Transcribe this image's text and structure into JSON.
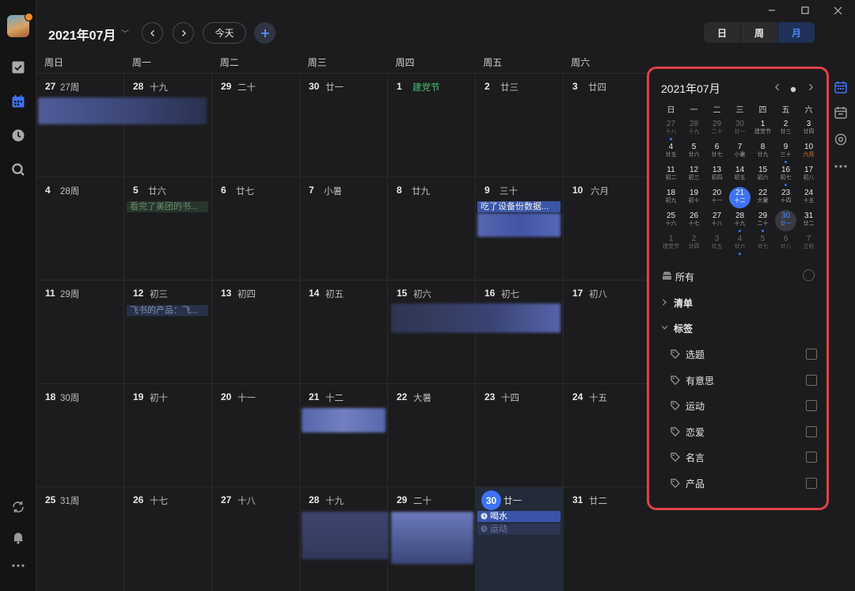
{
  "header": {
    "month_title": "2021年07月",
    "today_button": "今天",
    "view_modes": [
      "日",
      "周",
      "月"
    ],
    "active_view": "月"
  },
  "weekdays": [
    "周日",
    "周一",
    "周二",
    "周三",
    "周四",
    "周五",
    "周六"
  ],
  "weeks": [
    [
      {
        "day": "27",
        "info": "27周"
      },
      {
        "day": "28",
        "info": "十九"
      },
      {
        "day": "29",
        "info": "二十"
      },
      {
        "day": "30",
        "info": "廿一"
      },
      {
        "day": "1",
        "info": "建党节",
        "festival": true
      },
      {
        "day": "2",
        "info": "廿三"
      },
      {
        "day": "3",
        "info": "廿四"
      }
    ],
    [
      {
        "day": "4",
        "info": "28周"
      },
      {
        "day": "5",
        "info": "廿六"
      },
      {
        "day": "6",
        "info": "廿七"
      },
      {
        "day": "7",
        "info": "小暑"
      },
      {
        "day": "8",
        "info": "廿九"
      },
      {
        "day": "9",
        "info": "三十"
      },
      {
        "day": "10",
        "info": "六月"
      }
    ],
    [
      {
        "day": "11",
        "info": "29周"
      },
      {
        "day": "12",
        "info": "初三"
      },
      {
        "day": "13",
        "info": "初四"
      },
      {
        "day": "14",
        "info": "初五"
      },
      {
        "day": "15",
        "info": "初六"
      },
      {
        "day": "16",
        "info": "初七"
      },
      {
        "day": "17",
        "info": "初八"
      }
    ],
    [
      {
        "day": "18",
        "info": "30周"
      },
      {
        "day": "19",
        "info": "初十"
      },
      {
        "day": "20",
        "info": "十一"
      },
      {
        "day": "21",
        "info": "十二"
      },
      {
        "day": "22",
        "info": "大暑"
      },
      {
        "day": "23",
        "info": "十四"
      },
      {
        "day": "24",
        "info": "十五"
      }
    ],
    [
      {
        "day": "25",
        "info": "31周"
      },
      {
        "day": "26",
        "info": "十七"
      },
      {
        "day": "27",
        "info": "十八"
      },
      {
        "day": "28",
        "info": "十九"
      },
      {
        "day": "29",
        "info": "二十"
      },
      {
        "day": "30",
        "info": "廿一",
        "today": true
      },
      {
        "day": "31",
        "info": "廿二"
      }
    ]
  ],
  "events": {
    "book_done": "看完了美团的书...",
    "backup": "吃了设备份数据...",
    "feishu": "飞书的产品：飞...",
    "drink_water": "喝水",
    "exercise": "运动"
  },
  "mini_calendar": {
    "title": "2021年07月",
    "weekday_heads": [
      "日",
      "一",
      "二",
      "三",
      "四",
      "五",
      "六"
    ],
    "rows": [
      [
        {
          "n": "27",
          "l": "十八",
          "dim": true,
          "dot": true
        },
        {
          "n": "28",
          "l": "十九",
          "dim": true
        },
        {
          "n": "29",
          "l": "二十",
          "dim": true
        },
        {
          "n": "30",
          "l": "廿一",
          "dim": true
        },
        {
          "n": "1",
          "l": "建党节"
        },
        {
          "n": "2",
          "l": "廿三"
        },
        {
          "n": "3",
          "l": "廿四"
        }
      ],
      [
        {
          "n": "4",
          "l": "廿五"
        },
        {
          "n": "5",
          "l": "廿六"
        },
        {
          "n": "6",
          "l": "廿七"
        },
        {
          "n": "7",
          "l": "小暑"
        },
        {
          "n": "8",
          "l": "廿九"
        },
        {
          "n": "9",
          "l": "三十",
          "dot": true
        },
        {
          "n": "10",
          "l": "六月",
          "orange": true
        }
      ],
      [
        {
          "n": "11",
          "l": "初二"
        },
        {
          "n": "12",
          "l": "初三"
        },
        {
          "n": "13",
          "l": "初四"
        },
        {
          "n": "14",
          "l": "初五"
        },
        {
          "n": "15",
          "l": "初六"
        },
        {
          "n": "16",
          "l": "初七",
          "dot": true
        },
        {
          "n": "17",
          "l": "初八"
        }
      ],
      [
        {
          "n": "18",
          "l": "初九"
        },
        {
          "n": "19",
          "l": "初十"
        },
        {
          "n": "20",
          "l": "十一"
        },
        {
          "n": "21",
          "l": "十二",
          "sel": true
        },
        {
          "n": "22",
          "l": "大暑"
        },
        {
          "n": "23",
          "l": "十四"
        },
        {
          "n": "24",
          "l": "十五"
        }
      ],
      [
        {
          "n": "25",
          "l": "十六"
        },
        {
          "n": "26",
          "l": "十七"
        },
        {
          "n": "27",
          "l": "十八"
        },
        {
          "n": "28",
          "l": "十九",
          "dot": true
        },
        {
          "n": "29",
          "l": "二十",
          "dot": true
        },
        {
          "n": "30",
          "l": "廿一",
          "cur": true
        },
        {
          "n": "31",
          "l": "廿二"
        }
      ],
      [
        {
          "n": "1",
          "l": "建党节",
          "dim": true
        },
        {
          "n": "2",
          "l": "廿四",
          "dim": true
        },
        {
          "n": "3",
          "l": "廿五",
          "dim": true
        },
        {
          "n": "4",
          "l": "廿六",
          "dim": true,
          "dot": true
        },
        {
          "n": "5",
          "l": "廿七",
          "dim": true
        },
        {
          "n": "6",
          "l": "廿八",
          "dim": true
        },
        {
          "n": "7",
          "l": "立秋",
          "dim": true
        }
      ]
    ]
  },
  "sidebar": {
    "all_label": "所有",
    "lists_label": "清单",
    "tags_label": "标签",
    "tags": [
      "选题",
      "有意思",
      "运动",
      "恋爱",
      "名言",
      "产品"
    ]
  },
  "colors": {
    "accent": "#3e72f2",
    "highlight_border": "#e04049",
    "festival": "#4cc37a"
  }
}
